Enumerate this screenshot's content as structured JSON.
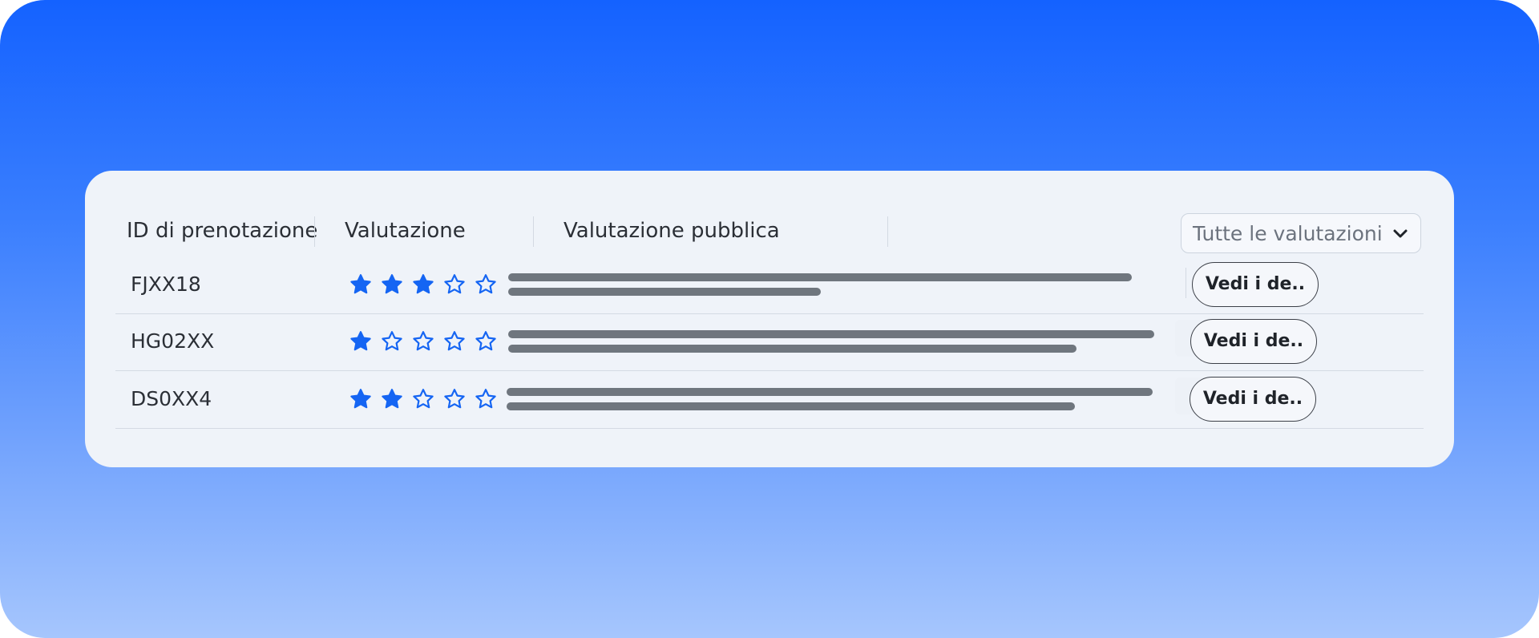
{
  "table": {
    "columns": [
      "ID di prenotazione",
      "Valutazione",
      "Valutazione pubblica"
    ],
    "filter": {
      "selected": "Tutte le valutazioni",
      "icon": "chevron-down-icon"
    },
    "rows": [
      {
        "id": "FJXX18",
        "rating": 3,
        "max_rating": 5,
        "public_status": "negative",
        "action_label": "Vedi i de.."
      },
      {
        "id": "HG02XX",
        "rating": 1,
        "max_rating": 5,
        "public_status": "none",
        "action_label": "Vedi i de.."
      },
      {
        "id": "DS0XX4",
        "rating": 2,
        "max_rating": 5,
        "public_status": "none",
        "action_label": "Vedi i de.."
      }
    ]
  },
  "colors": {
    "accent": "#1462FF",
    "star": "#1565F3",
    "negative_badge_bg": "#FBACB5",
    "negative_badge_fg": "#8E0A1F",
    "placeholder_text": "#6F767E"
  }
}
